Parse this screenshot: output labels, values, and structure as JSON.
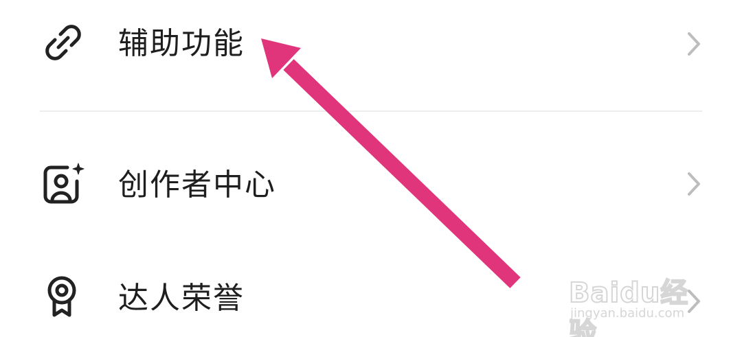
{
  "menu": {
    "items": [
      {
        "label": "辅助功能",
        "icon": "link-icon"
      },
      {
        "label": "创作者中心",
        "icon": "creator-portrait-icon"
      },
      {
        "label": "达人荣誉",
        "icon": "medal-icon"
      }
    ]
  },
  "watermark": {
    "brand": "Baidu经验",
    "url": "jingyan.baidu.com"
  },
  "colors": {
    "arrow": "#e0357a",
    "text": "#1e1e1e",
    "chevron": "#bdbdbd",
    "divider": "#ededed"
  }
}
